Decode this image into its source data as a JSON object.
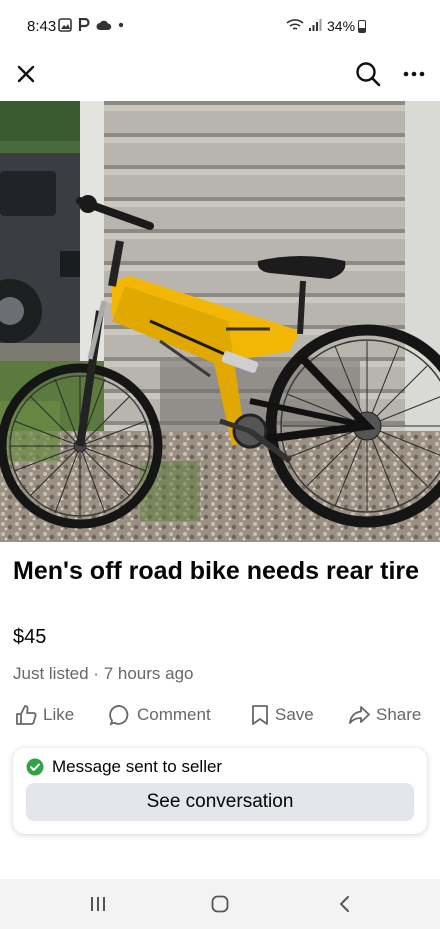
{
  "status_bar": {
    "time": "8:43",
    "battery": "34%",
    "left_icons": [
      "gallery-icon",
      "p-icon",
      "cloud-icon",
      "dot-icon"
    ],
    "right_icons": [
      "wifi-icon",
      "signal-icon",
      "battery-icon"
    ]
  },
  "app_bar": {
    "close_icon": "close-icon",
    "search_icon": "search-icon",
    "more_icon": "more-icon"
  },
  "listing": {
    "title": "Men's off road bike needs rear tire",
    "price": "$45",
    "listed": "Just listed · 7 hours ago"
  },
  "actions": {
    "like": "Like",
    "comment": "Comment",
    "save": "Save",
    "share": "Share"
  },
  "message": {
    "status": "Message sent to seller",
    "button": "See conversation",
    "status_color": "#31a24c"
  },
  "colors": {
    "text_primary": "#050505",
    "text_secondary": "#65676b",
    "button_bg": "#e4e6eb",
    "bike_yellow": "#f2b705"
  }
}
